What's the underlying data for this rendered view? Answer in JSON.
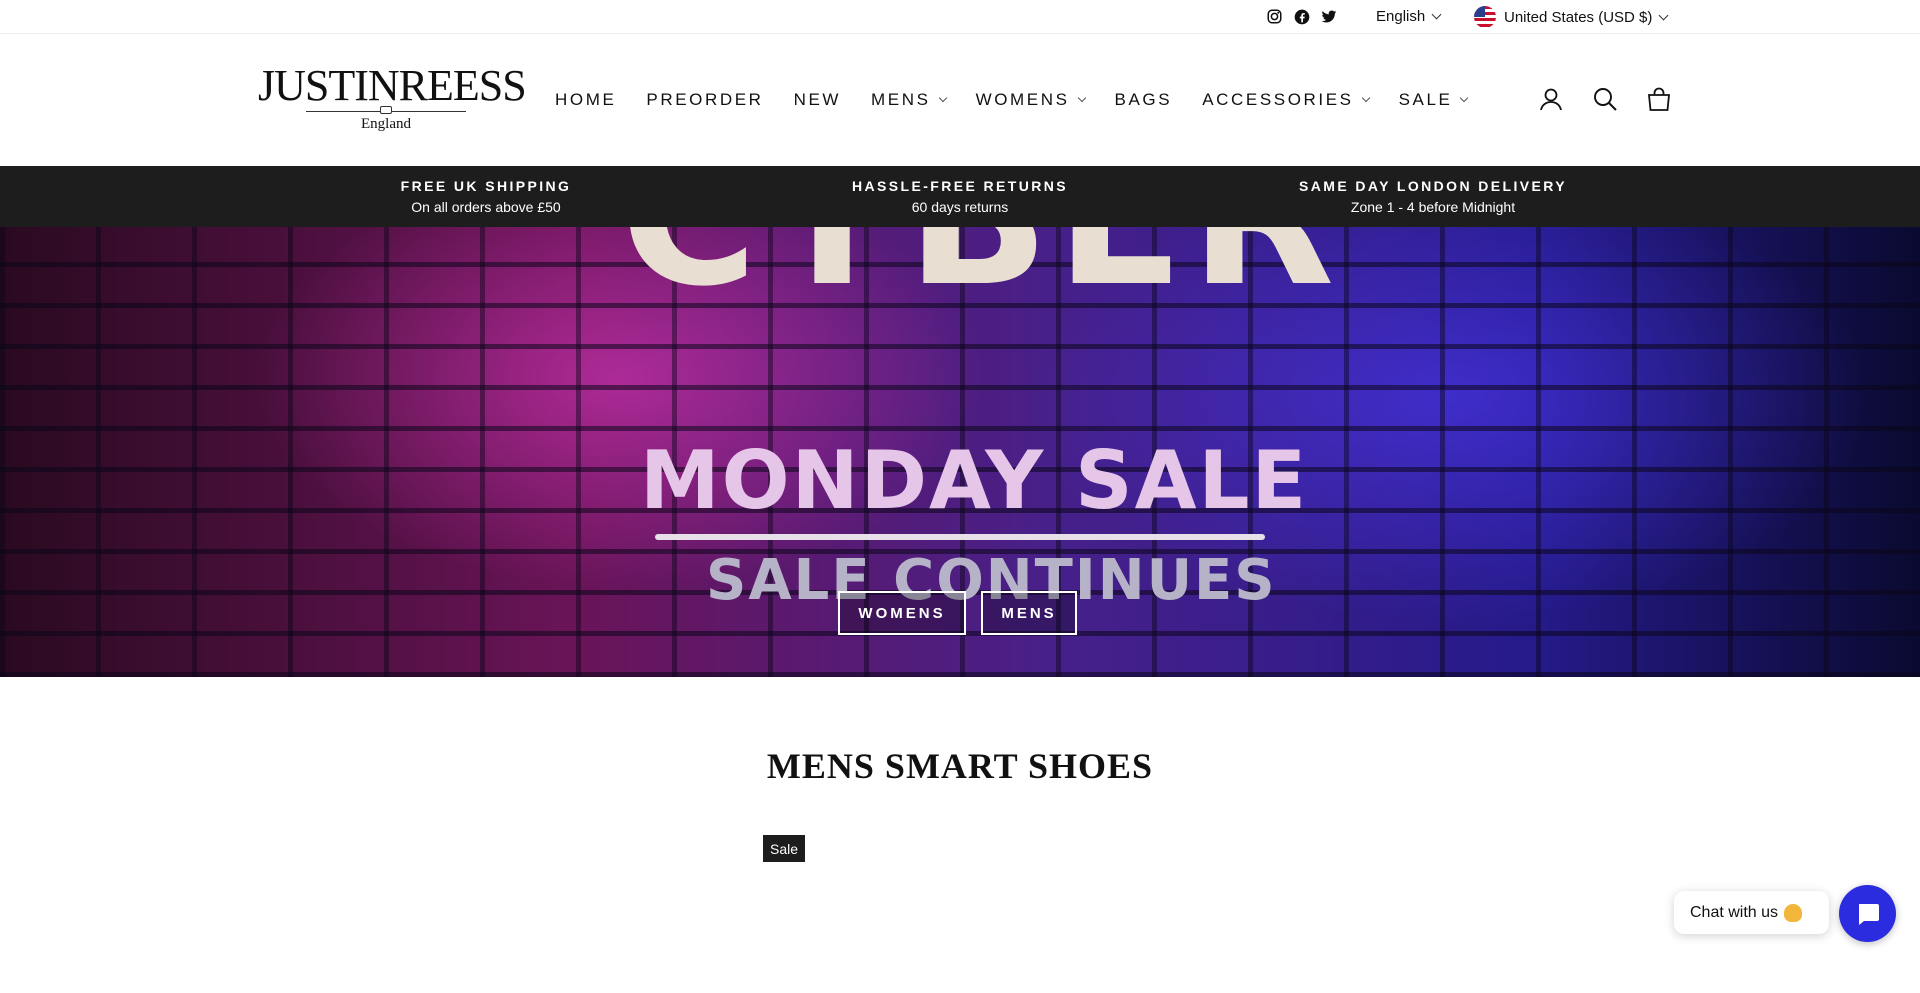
{
  "topbar": {
    "social": [
      "instagram-icon",
      "facebook-icon",
      "twitter-icon"
    ],
    "language": "English",
    "currency": "United States (USD $)"
  },
  "header": {
    "logo_text": "JUSTINREESS",
    "logo_sub": "England",
    "nav": [
      {
        "label": "HOME",
        "dropdown": false
      },
      {
        "label": "PREORDER",
        "dropdown": false
      },
      {
        "label": "NEW",
        "dropdown": false
      },
      {
        "label": "MENS",
        "dropdown": true
      },
      {
        "label": "WOMENS",
        "dropdown": true
      },
      {
        "label": "BAGS",
        "dropdown": false
      },
      {
        "label": "ACCESSORIES",
        "dropdown": true
      },
      {
        "label": "SALE",
        "dropdown": true
      }
    ],
    "icons": [
      "account-icon",
      "search-icon",
      "cart-icon"
    ]
  },
  "announcements": [
    {
      "title": "FREE UK SHIPPING",
      "sub": "On all orders above £50"
    },
    {
      "title": "HASSLE-FREE RETURNS",
      "sub": "60 days returns"
    },
    {
      "title": "SAME DAY LONDON DELIVERY",
      "sub": "Zone 1 - 4 before Midnight"
    }
  ],
  "hero": {
    "line1": "CYBER",
    "line2": "MONDAY SALE",
    "line3": "SALE CONTINUES",
    "buttons": [
      "WOMENS",
      "MENS"
    ]
  },
  "section": {
    "title": "MENS SMART SHOES",
    "badge": "Sale"
  },
  "chat": {
    "label": "Chat with us"
  },
  "colors": {
    "announce_bg": "#1d1d1d",
    "chat_accent": "#2b2be0"
  }
}
